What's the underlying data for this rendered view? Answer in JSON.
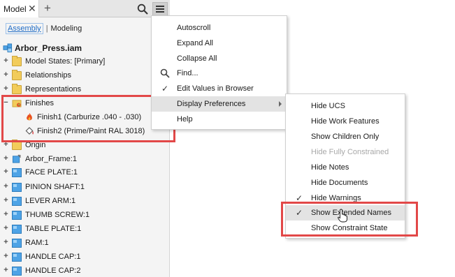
{
  "tabs": {
    "model_label": "Model",
    "close": "✕",
    "add": "+"
  },
  "subtabs": {
    "assembly": "Assembly",
    "separator": "|",
    "modeling": "Modeling"
  },
  "tree": {
    "root": "Arbor_Press.iam",
    "model_states": "Model States: [Primary]",
    "relationships": "Relationships",
    "representations": "Representations",
    "finishes": "Finishes",
    "finish1": "Finish1 (Carburize .040 - .030)",
    "finish2": "Finish2 (Prime/Paint RAL 3018)",
    "origin": "Origin",
    "parts": [
      "Arbor_Frame:1",
      "FACE PLATE:1",
      "PINION SHAFT:1",
      "LEVER ARM:1",
      "THUMB SCREW:1",
      "TABLE PLATE:1",
      "RAM:1",
      "HANDLE CAP:1",
      "HANDLE CAP:2"
    ]
  },
  "menu": {
    "autoscroll": "Autoscroll",
    "expand_all": "Expand All",
    "collapse_all": "Collapse All",
    "find": "Find...",
    "edit_values": "Edit Values in Browser",
    "display_prefs": "Display Preferences",
    "help": "Help"
  },
  "submenu": {
    "hide_ucs": "Hide UCS",
    "hide_work_features": "Hide Work Features",
    "show_children_only": "Show Children Only",
    "hide_fully_constrained": "Hide Fully Constrained",
    "hide_notes": "Hide Notes",
    "hide_documents": "Hide Documents",
    "hide_warnings": "Hide Warnings",
    "show_extended_names": "Show Extended Names",
    "show_constraint_state": "Show Constraint State"
  },
  "checks": {
    "mark": "✓"
  },
  "colors": {
    "accent": "#1f6cc6",
    "annotation": "#e24848",
    "folder": "#f2cc5b",
    "part": "#4ea3e6"
  }
}
